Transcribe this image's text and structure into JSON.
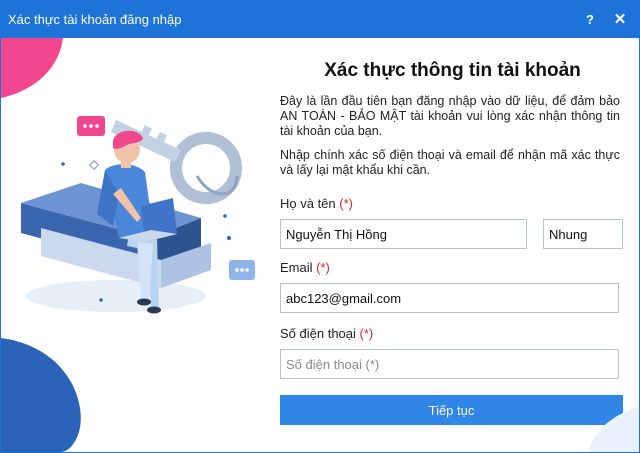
{
  "window": {
    "title": "Xác thực tài khoản đăng nhập",
    "help_label": "?",
    "close_label": "✕"
  },
  "form": {
    "heading": "Xác thực thông tin tài khoản",
    "intro": "Đây là lần đầu tiên bạn đăng nhập vào dữ liệu, để đảm bảo AN TOÀN - BẢO MẬT tài khoản vui lòng xác nhận thông tin tài khoản của bạn.",
    "instruction": "Nhập chính xác số điện thoại và email để nhận mã xác thực và lấy lại mật khẩu khi cần.",
    "name_label": "Họ và tên",
    "email_label": "Email",
    "phone_label": "Số điện thoại",
    "required_mark": "(*)",
    "fullname_value": "Nguyễn Thị Hồng",
    "given_name_value": "Nhung",
    "email_value": "abc123@gmail.com",
    "phone_value": "",
    "phone_placeholder": "Số điện thoại (*)",
    "submit_label": "Tiếp tục"
  },
  "colors": {
    "titlebar": "#1e73d8",
    "button": "#2f86e6",
    "required": "#d62828",
    "accent_pink": "#f0478e",
    "accent_blue": "#2a63b8"
  }
}
